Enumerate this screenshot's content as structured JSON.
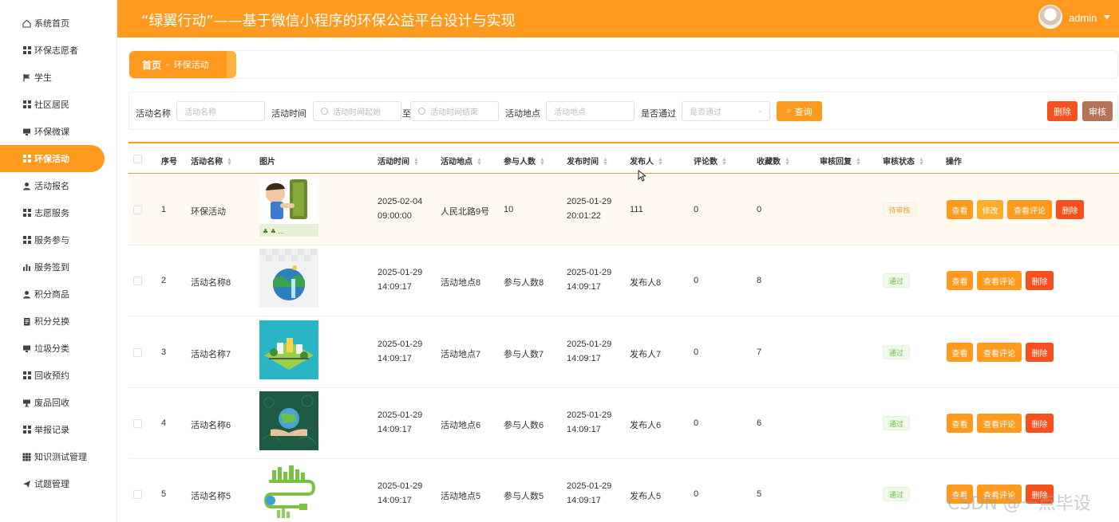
{
  "sidebar": {
    "items": [
      {
        "label": "系统首页",
        "icon": "home-icon"
      },
      {
        "label": "环保志愿者",
        "icon": "grid-icon"
      },
      {
        "label": "学生",
        "icon": "flag-icon"
      },
      {
        "label": "社区居民",
        "icon": "grid-icon"
      },
      {
        "label": "环保微课",
        "icon": "monitor-icon"
      },
      {
        "label": "环保活动",
        "icon": "grid-icon",
        "active": true
      },
      {
        "label": "活动报名",
        "icon": "user-icon"
      },
      {
        "label": "志愿服务",
        "icon": "grid-icon"
      },
      {
        "label": "服务参与",
        "icon": "grid-icon"
      },
      {
        "label": "服务签到",
        "icon": "bar-chart-icon"
      },
      {
        "label": "积分商品",
        "icon": "user-icon"
      },
      {
        "label": "积分兑换",
        "icon": "document-icon"
      },
      {
        "label": "垃圾分类",
        "icon": "monitor-icon"
      },
      {
        "label": "回收预约",
        "icon": "grid-icon"
      },
      {
        "label": "废品回收",
        "icon": "trophy-icon"
      },
      {
        "label": "举报记录",
        "icon": "grid-icon"
      },
      {
        "label": "知识测试管理",
        "icon": "apps-icon"
      },
      {
        "label": "试题管理",
        "icon": "send-icon"
      }
    ]
  },
  "header": {
    "title": "“绿翼行动”——基于微信小程序的环保公益平台设计与实现",
    "user": "admin",
    "bg_color": "#ff9a1e"
  },
  "breadcrumb": {
    "home": "首页",
    "sep": "-",
    "current": "环保活动"
  },
  "search": {
    "name_label": "活动名称",
    "name_placeholder": "活动名称",
    "time_label": "活动时间",
    "time_start_placeholder": "活动时间起始",
    "to": "至",
    "time_end_placeholder": "活动时间结束",
    "place_label": "活动地点",
    "place_placeholder": "活动地点",
    "pass_label": "是否通过",
    "pass_placeholder": "是否通过",
    "query_label": "查询",
    "delete_label": "删除",
    "review_label": "审核"
  },
  "table": {
    "headers": {
      "index": "序号",
      "name": "活动名称",
      "image": "图片",
      "time": "活动时间",
      "place": "活动地点",
      "count": "参与人数",
      "publish_time": "发布时间",
      "publisher": "发布人",
      "comments": "评论数",
      "favorites": "收藏数",
      "reply": "审核回复",
      "status": "审核状态",
      "actions": "操作"
    },
    "rows": [
      {
        "index": "1",
        "name": "环保活动",
        "time": "2025-02-04 09:00:00",
        "place": "人民北路9号",
        "count": "10",
        "publish_time": "2025-01-29 20:01:22",
        "publisher": "111",
        "comments": "0",
        "favorites": "0",
        "status": "待审核",
        "pending": true,
        "image": "kid-tree"
      },
      {
        "index": "2",
        "name": "活动名称8",
        "time": "2025-01-29 14:09:17",
        "place": "活动地点8",
        "count": "参与人数8",
        "publish_time": "2025-01-29 14:09:17",
        "publisher": "发布人8",
        "comments": "0",
        "favorites": "8",
        "status": "通过",
        "image": "earth-waterfall"
      },
      {
        "index": "3",
        "name": "活动名称7",
        "time": "2025-01-29 14:09:17",
        "place": "活动地点7",
        "count": "参与人数7",
        "publish_time": "2025-01-29 14:09:17",
        "publisher": "发布人7",
        "comments": "0",
        "favorites": "7",
        "status": "通过",
        "image": "green-city"
      },
      {
        "index": "4",
        "name": "活动名称6",
        "time": "2025-01-29 14:09:17",
        "place": "活动地点6",
        "count": "参与人数6",
        "publish_time": "2025-01-29 14:09:17",
        "publisher": "发布人6",
        "comments": "0",
        "favorites": "6",
        "status": "通过",
        "image": "hands-earth"
      },
      {
        "index": "5",
        "name": "活动名称5",
        "time": "2025-01-29 14:09:17",
        "place": "活动地点5",
        "count": "参与人数5",
        "publish_time": "2025-01-29 14:09:17",
        "publisher": "发布人5",
        "comments": "0",
        "favorites": "5",
        "status": "通过",
        "image": "plug-city"
      }
    ],
    "actions": {
      "view": "查看",
      "edit": "修改",
      "view_comments": "查看评论",
      "delete": "删除"
    }
  },
  "watermark": "CSDN @一点毕设"
}
